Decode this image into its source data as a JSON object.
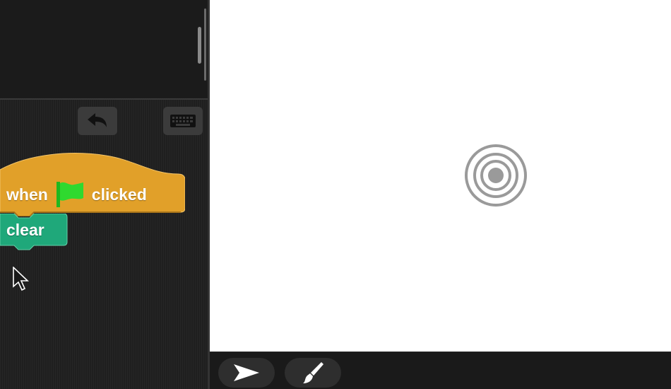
{
  "palette": {
    "scrollbar": true
  },
  "toolbar": {
    "undo_icon": "undo-arrow-icon",
    "keyboard_icon": "keyboard-icon"
  },
  "script": {
    "hat_block": {
      "word1": "when",
      "flag_icon": "green-flag-icon",
      "word2": "clicked",
      "color": "#e1a029"
    },
    "command_block": {
      "label": "clear",
      "color": "#1fa87a"
    }
  },
  "stage": {
    "background": "#ffffff",
    "sprite_icon": "concentric-circles-sprite-icon"
  },
  "corral": {
    "turtle_icon": "turtle-arrow-icon",
    "paintbrush_icon": "paintbrush-icon"
  },
  "colors": {
    "hat_block": "#e1a029",
    "pen_block": "#1fa87a",
    "flag": "#2fd92f"
  }
}
